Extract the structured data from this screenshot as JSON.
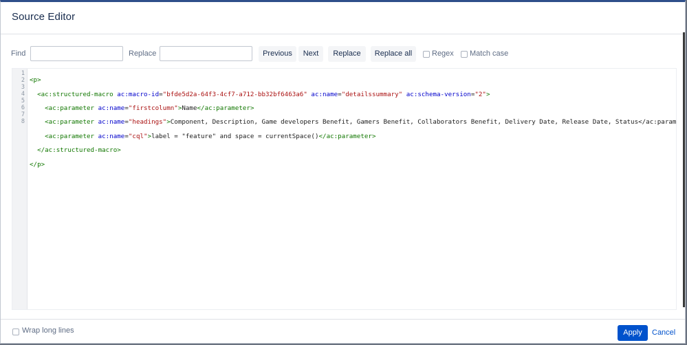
{
  "dialog": {
    "title": "Source Editor"
  },
  "toolbar": {
    "find_label": "Find",
    "find_value": "",
    "replace_label": "Replace",
    "replace_value": "",
    "previous_label": "Previous",
    "next_label": "Next",
    "replace_button_label": "Replace",
    "replace_all_label": "Replace all",
    "regex_label": "Regex",
    "regex_checked": false,
    "match_case_label": "Match case",
    "match_case_checked": false
  },
  "editor": {
    "line_numbers": [
      "1",
      "2",
      "3",
      "4",
      "5",
      "6",
      "7",
      "8"
    ],
    "tokens": {
      "p_open": "<p>",
      "macro_open": "<ac:structured-macro",
      "macro_id_attr": "ac:macro-id",
      "macro_id_value": "\"bfde5d2a-64f3-4cf7-a712-bb32bf6463a6\"",
      "name_attr": "ac:name",
      "macro_name_value": "\"detailssummary\"",
      "schema_attr": "ac:schema-version",
      "schema_value": "\"2\"",
      "gt": ">",
      "param_open": "<ac:parameter",
      "param_close": "</ac:parameter>",
      "firstcolumn_value": "\"firstcolumn\"",
      "firstcolumn_text": "Name",
      "headings_value": "\"headings\"",
      "headings_text": "Component, Description, Game developers Benefit, Gamers Benefit, Collaborators Benefit, Delivery Date, Release Date, Status</ac:parameter>",
      "cql_value": "\"cql\"",
      "cql_text": "label = \"feature\" and space = currentSpace()",
      "macro_close": "</ac:structured-macro>",
      "p_close": "</p>",
      "eq": "="
    }
  },
  "footer": {
    "wrap_label": "Wrap long lines",
    "wrap_checked": false,
    "apply_label": "Apply",
    "cancel_label": "Cancel"
  },
  "colors": {
    "primary": "#0052cc",
    "tag": "#117700",
    "attribute": "#0000cc",
    "string": "#aa1111"
  }
}
